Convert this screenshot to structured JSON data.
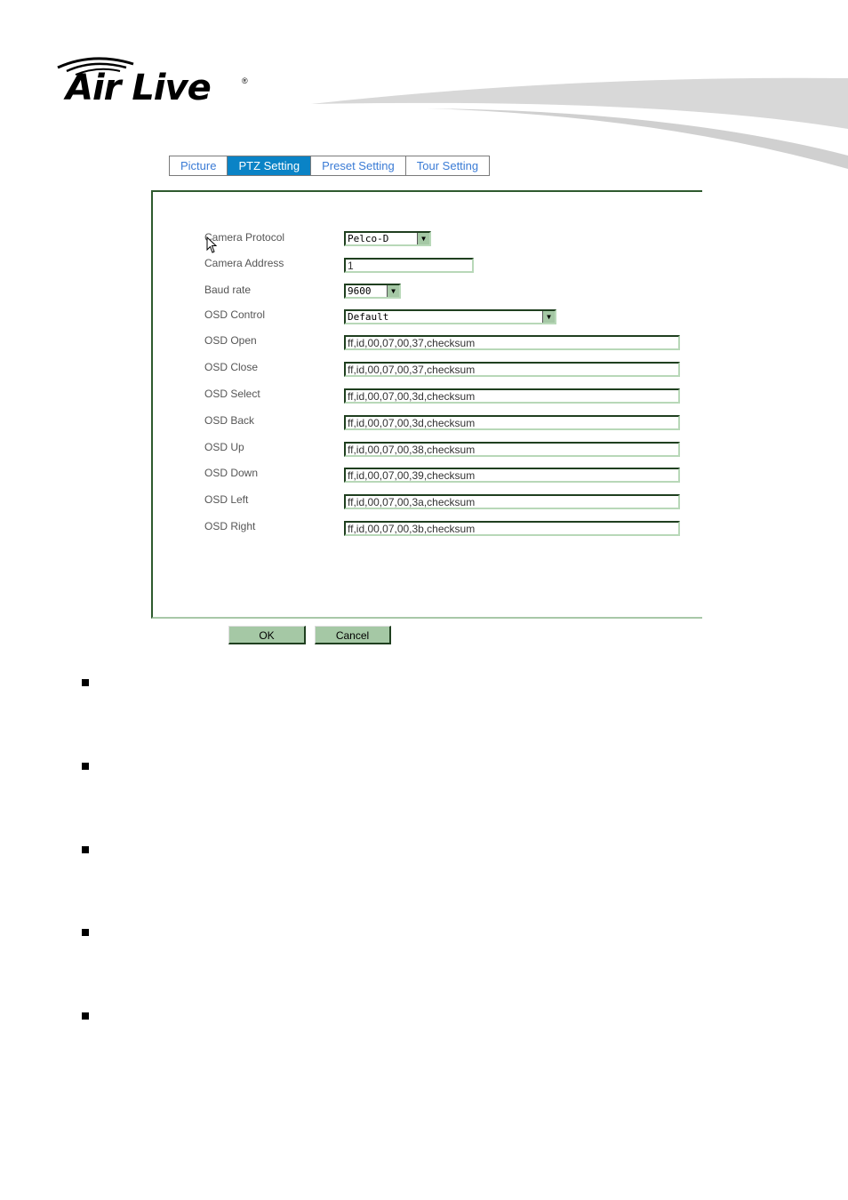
{
  "brand": {
    "logo_text": "Air Live"
  },
  "tabs": [
    {
      "label": "Picture",
      "active": false
    },
    {
      "label": "PTZ Setting",
      "active": true
    },
    {
      "label": "Preset Setting",
      "active": false
    },
    {
      "label": "Tour Setting",
      "active": false
    }
  ],
  "form": {
    "camera_protocol": {
      "label": "Camera Protocol",
      "value": "Pelco-D"
    },
    "camera_address": {
      "label": "Camera Address",
      "value": "1"
    },
    "baud_rate": {
      "label": "Baud rate",
      "value": "9600"
    },
    "osd_control": {
      "label": "OSD Control",
      "value": "Default"
    },
    "osd_fields": [
      {
        "label": "OSD Open",
        "value": "ff,id,00,07,00,37,checksum"
      },
      {
        "label": "OSD Close",
        "value": "ff,id,00,07,00,37,checksum"
      },
      {
        "label": "OSD Select",
        "value": "ff,id,00,07,00,3d,checksum"
      },
      {
        "label": "OSD Back",
        "value": "ff,id,00,07,00,3d,checksum"
      },
      {
        "label": "OSD Up",
        "value": "ff,id,00,07,00,38,checksum"
      },
      {
        "label": "OSD Down",
        "value": "ff,id,00,07,00,39,checksum"
      },
      {
        "label": "OSD Left",
        "value": "ff,id,00,07,00,3a,checksum"
      },
      {
        "label": "OSD Right",
        "value": "ff,id,00,07,00,3b,checksum"
      }
    ]
  },
  "buttons": {
    "ok": "OK",
    "cancel": "Cancel"
  },
  "colors": {
    "active_tab": "#0a83c6",
    "tab_text": "#3a7bd5",
    "button": "#a5c8a5"
  }
}
